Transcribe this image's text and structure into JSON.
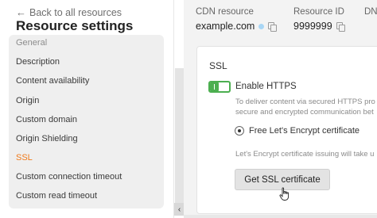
{
  "sidebar": {
    "back_label": "Back to all resources",
    "title": "Resource settings",
    "items": [
      {
        "label": "General"
      },
      {
        "label": "Description"
      },
      {
        "label": "Content availability"
      },
      {
        "label": "Origin"
      },
      {
        "label": "Custom domain"
      },
      {
        "label": "Origin Shielding"
      },
      {
        "label": "SSL"
      },
      {
        "label": "Custom connection timeout"
      },
      {
        "label": "Custom read timeout"
      }
    ],
    "active_item": "SSL"
  },
  "resource_info": {
    "cdn_label": "CDN resource",
    "cdn_value": "example.com",
    "id_label": "Resource ID",
    "id_value": "9999999",
    "dn_label": "DN"
  },
  "ssl_card": {
    "title": "SSL",
    "toggle_label": "Enable HTTPS",
    "toggle_on": true,
    "description_line1": "To deliver content via secured HTTPS pro",
    "description_line2": "secure and encrypted communication bet",
    "radio_label": "Free Let's Encrypt certificate",
    "note": "Let's Encrypt certificate issuing will take u",
    "button_label": "Get SSL certificate"
  },
  "colors": {
    "accent_active": "#f07a1a",
    "toggle_green": "#4caf50",
    "status_dot": "#a9d6f5"
  }
}
